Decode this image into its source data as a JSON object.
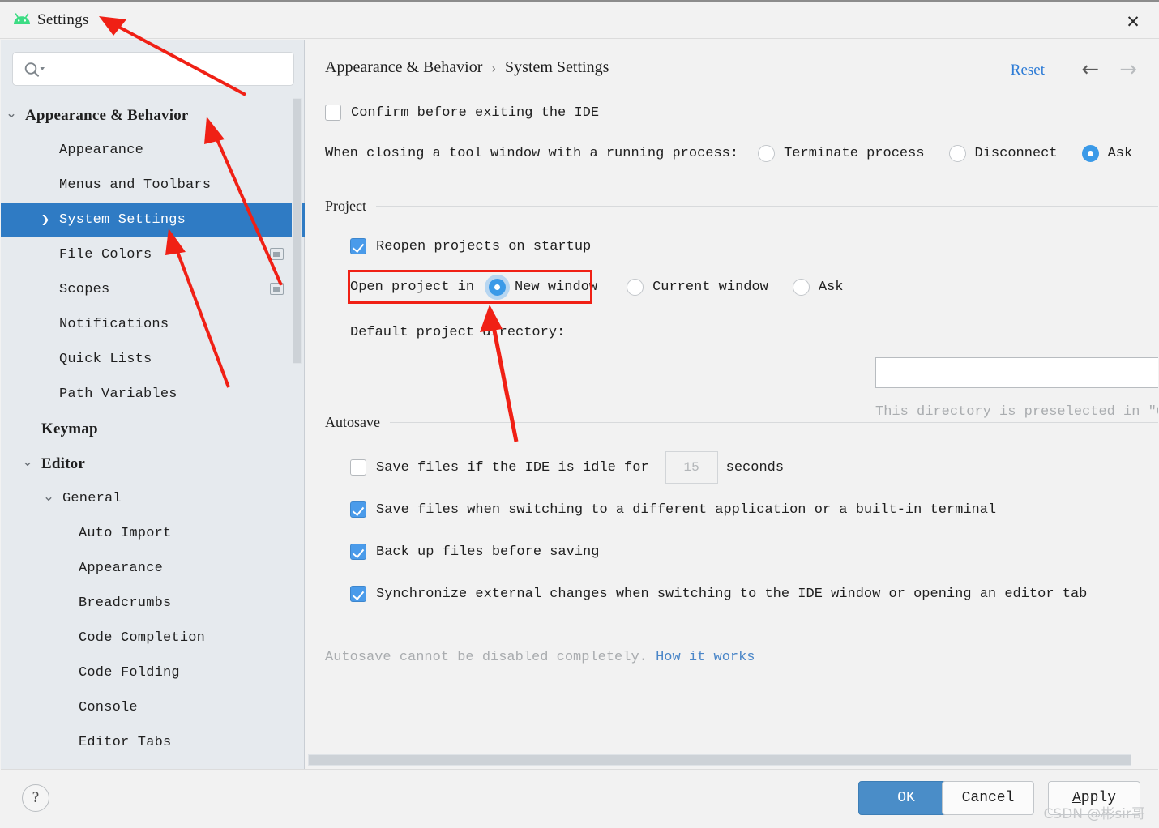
{
  "window": {
    "title": "Settings",
    "logo_icon": "android-logo-icon",
    "close_icon": "close-icon"
  },
  "sidebar": {
    "search": {
      "value": "",
      "placeholder": "",
      "icon": "search-icon"
    },
    "items": [
      {
        "label": "Appearance & Behavior",
        "indent": 30,
        "bold": true,
        "caret": "chevron-down",
        "selected": false,
        "badge": false
      },
      {
        "label": "Appearance",
        "indent": 72,
        "bold": false,
        "caret": "",
        "selected": false,
        "badge": false
      },
      {
        "label": "Menus and Toolbars",
        "indent": 72,
        "bold": false,
        "caret": "",
        "selected": false,
        "badge": false
      },
      {
        "label": "System Settings",
        "indent": 72,
        "bold": false,
        "caret": "chevron-right",
        "selected": true,
        "badge": false
      },
      {
        "label": "File Colors",
        "indent": 72,
        "bold": false,
        "caret": "",
        "selected": false,
        "badge": true
      },
      {
        "label": "Scopes",
        "indent": 72,
        "bold": false,
        "caret": "",
        "selected": false,
        "badge": true
      },
      {
        "label": "Notifications",
        "indent": 72,
        "bold": false,
        "caret": "",
        "selected": false,
        "badge": false
      },
      {
        "label": "Quick Lists",
        "indent": 72,
        "bold": false,
        "caret": "",
        "selected": false,
        "badge": false
      },
      {
        "label": "Path Variables",
        "indent": 72,
        "bold": false,
        "caret": "",
        "selected": false,
        "badge": false
      },
      {
        "label": "Keymap",
        "indent": 50,
        "bold": true,
        "caret": "",
        "selected": false,
        "badge": false
      },
      {
        "label": "Editor",
        "indent": 50,
        "bold": true,
        "caret": "chevron-down",
        "selected": false,
        "badge": false
      },
      {
        "label": "General",
        "indent": 76,
        "bold": false,
        "caret": "chevron-down",
        "selected": false,
        "badge": false
      },
      {
        "label": "Auto Import",
        "indent": 96,
        "bold": false,
        "caret": "",
        "selected": false,
        "badge": false
      },
      {
        "label": "Appearance",
        "indent": 96,
        "bold": false,
        "caret": "",
        "selected": false,
        "badge": false
      },
      {
        "label": "Breadcrumbs",
        "indent": 96,
        "bold": false,
        "caret": "",
        "selected": false,
        "badge": false
      },
      {
        "label": "Code Completion",
        "indent": 96,
        "bold": false,
        "caret": "",
        "selected": false,
        "badge": false
      },
      {
        "label": "Code Folding",
        "indent": 96,
        "bold": false,
        "caret": "",
        "selected": false,
        "badge": false
      },
      {
        "label": "Console",
        "indent": 96,
        "bold": false,
        "caret": "",
        "selected": false,
        "badge": false
      },
      {
        "label": "Editor Tabs",
        "indent": 96,
        "bold": false,
        "caret": "",
        "selected": false,
        "badge": false
      }
    ]
  },
  "main": {
    "breadcrumb": {
      "parent": "Appearance & Behavior",
      "separator": "›",
      "current": "System Settings"
    },
    "reset_label": "Reset",
    "nav_back_icon": "arrow-left-icon",
    "nav_forward_icon": "arrow-right-icon",
    "confirm_exit": {
      "label": "Confirm before exiting the IDE",
      "checked": false
    },
    "closing_tool_window": {
      "label": "When closing a tool window with a running process:",
      "options": [
        {
          "label": "Terminate process",
          "selected": false
        },
        {
          "label": "Disconnect",
          "selected": false
        },
        {
          "label": "Ask",
          "selected": true
        }
      ]
    },
    "project_group": {
      "title": "Project",
      "reopen": {
        "label": "Reopen projects on startup",
        "checked": true
      },
      "open_project_in": {
        "label": "Open project in",
        "options": [
          {
            "label": "New window",
            "selected": true,
            "focused": true
          },
          {
            "label": "Current window",
            "selected": false,
            "focused": false
          },
          {
            "label": "Ask",
            "selected": false,
            "focused": false
          }
        ]
      },
      "default_dir": {
        "label": "Default project directory:",
        "value": "",
        "placeholder": "",
        "browse_icon": "folder-icon",
        "hint": "This directory is preselected in \"Open...\" and \"New | Project...\" dialogs"
      }
    },
    "autosave_group": {
      "title": "Autosave",
      "idle_save": {
        "label_before": "Save files if the IDE is idle for",
        "seconds_value": "15",
        "label_after": "seconds",
        "checked": false
      },
      "checkboxes": [
        {
          "label": "Save files when switching to a different application or a built-in terminal",
          "checked": true
        },
        {
          "label": "Back up files before saving",
          "checked": true
        },
        {
          "label": "Synchronize external changes when switching to the IDE window or opening an editor tab",
          "checked": true
        }
      ],
      "footnote_text": "Autosave cannot be disabled completely.",
      "footnote_link": "How it works"
    }
  },
  "footer": {
    "help_label": "?",
    "ok_label": "OK",
    "cancel_label": "Cancel",
    "apply_label_mnemonic": "A",
    "apply_label_rest": "pply"
  },
  "watermark": "CSDN @彬sir哥",
  "colors": {
    "accent_blue": "#2f7bc4",
    "link_blue": "#2e7cd6",
    "checkbox_blue": "#4a9bea",
    "radio_blue": "#3b9ae8",
    "ok_button_blue": "#4a8dc8",
    "sidebar_bg": "#e6eaee",
    "panel_bg": "#f2f2f2",
    "annotation_red": "#f02015",
    "android_green": "#3ddc84"
  }
}
